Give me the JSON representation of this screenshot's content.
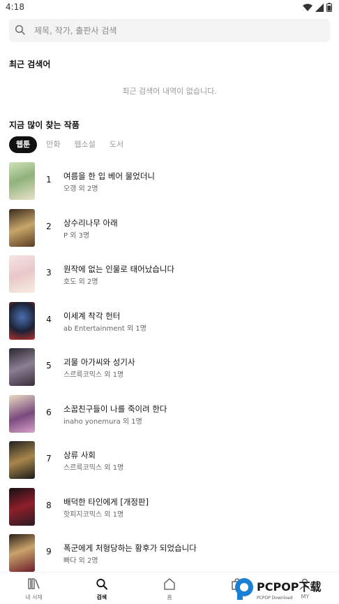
{
  "status": {
    "time": "4:18"
  },
  "search": {
    "placeholder": "제목, 작가, 출판사 검색"
  },
  "recent": {
    "title": "최근 검색어",
    "empty": "최근 검색어 내역이 없습니다."
  },
  "popular": {
    "title": "지금 많이 찾는 작품",
    "tabs": [
      "웹툰",
      "만화",
      "웹소설",
      "도서"
    ],
    "items": [
      {
        "rank": "1",
        "title": "여름을 한 입 베어 물었더니",
        "author": "오갱 외 2명"
      },
      {
        "rank": "2",
        "title": "상수리나무 아래",
        "author": "P 외 3명"
      },
      {
        "rank": "3",
        "title": "원작에 없는 인물로 태어났습니다",
        "author": "호도 외 2명"
      },
      {
        "rank": "4",
        "title": "이세계 착각 헌터",
        "author": "ab Entertainment 외 1명"
      },
      {
        "rank": "5",
        "title": "괴물 아가씨와 성기사",
        "author": "스르륵코믹스 외 1명"
      },
      {
        "rank": "6",
        "title": "소꿉친구들이 나를 죽이려 한다",
        "author": "inaho yonemura 외 1명"
      },
      {
        "rank": "7",
        "title": "상류 사회",
        "author": "스르륵코믹스 외 1명"
      },
      {
        "rank": "8",
        "title": "배덕한 타인에게 [개정판]",
        "author": "핫피지코믹스 외 1명"
      },
      {
        "rank": "9",
        "title": "폭군에게 처형당하는 황후가 되었습니다",
        "author": "빠다 외 2명"
      }
    ]
  },
  "nav": {
    "library": "내 서재",
    "search": "검색",
    "home": "홈",
    "shop": "MY",
    "my": "MY"
  },
  "watermark": {
    "brand": "PCPOP下载",
    "sub": "PCPOP Download"
  },
  "colors": {
    "active_tab_bg": "#111111",
    "search_bg": "#f3f3f3"
  }
}
